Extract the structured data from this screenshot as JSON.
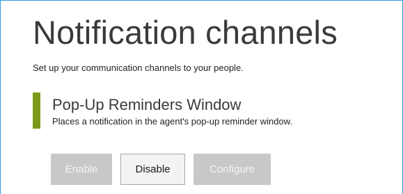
{
  "page": {
    "title": "Notification channels",
    "subtitle": "Set up your communication channels to your people."
  },
  "channel": {
    "title": "Pop-Up Reminders Window",
    "description": "Places a notification in the agent's pop-up reminder window.",
    "accent_color": "#7a9a1a"
  },
  "actions": {
    "enable_label": "Enable",
    "enable_state": "disabled",
    "disable_label": "Disable",
    "disable_state": "enabled",
    "configure_label": "Configure",
    "configure_state": "disabled"
  },
  "colors": {
    "frame_border": "#2f9ae0",
    "disabled_button": "#c8c8c8"
  }
}
